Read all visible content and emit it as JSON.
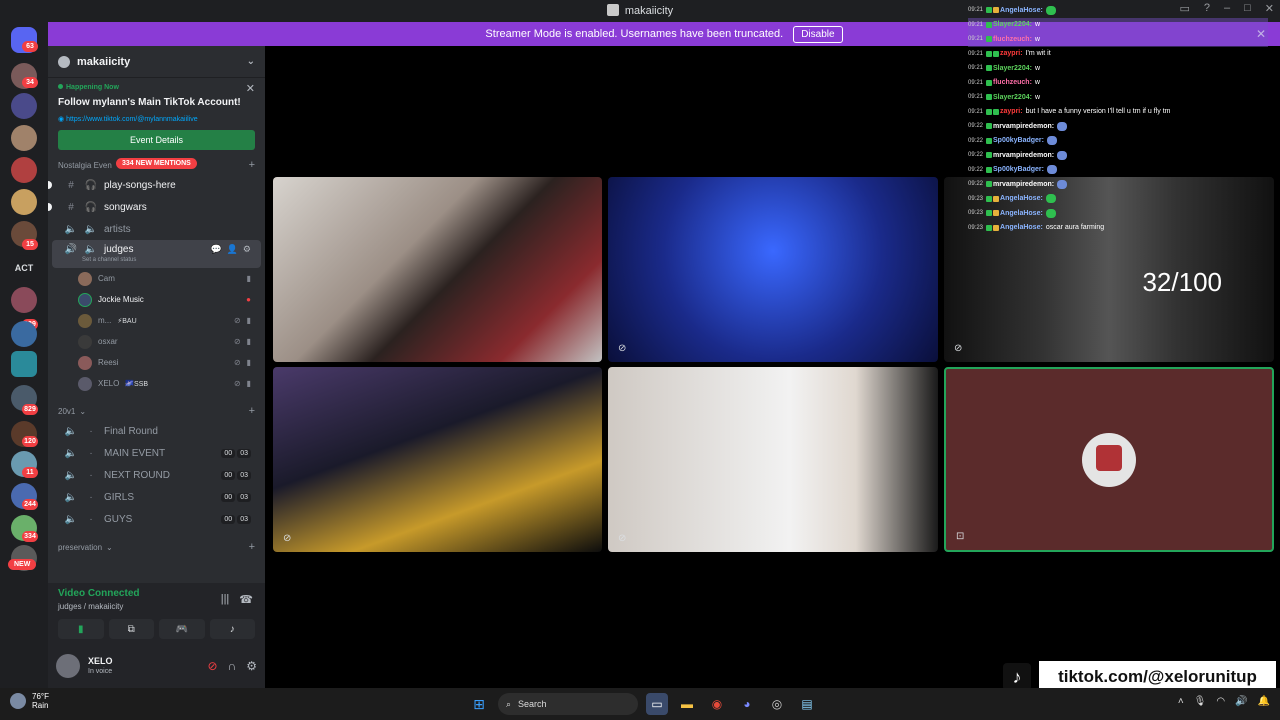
{
  "window": {
    "title": "makaiicity"
  },
  "banner": {
    "text": "Streamer Mode is enabled. Usernames have been truncated.",
    "button": "Disable"
  },
  "servers": {
    "badges": [
      "63",
      "34",
      "15",
      "129",
      "829",
      "120",
      "11",
      "244",
      "334"
    ],
    "text_item": "ACT",
    "new_label": "NEW"
  },
  "sidebar": {
    "server_name": "makaiicity",
    "event": {
      "status": "Happening Now",
      "title": "Follow mylann's Main TikTok Account!",
      "link": "https://www.tiktok.com/@mylannmakaiilive",
      "button": "Event Details"
    },
    "categories": {
      "nostalgia": "Nostalgia Even",
      "mentions_pill": "334 NEW MENTIONS",
      "twenty_v1": "20v1",
      "preservation": "preservation"
    },
    "channels_top": [
      {
        "name": "play-songs-here",
        "unread": true
      },
      {
        "name": "songwars",
        "unread": true
      },
      {
        "name": "artists",
        "unread": false
      }
    ],
    "active_channel": {
      "name": "judges",
      "status": "Set a channel status"
    },
    "voice_users": [
      {
        "name": "Cam",
        "tag": "",
        "speaking": false,
        "color": "#8a6a5a"
      },
      {
        "name": "Jockie Music",
        "tag": "",
        "speaking": true,
        "color": "#3b4a6b"
      },
      {
        "name": "m...",
        "tag": "⚡BAU",
        "speaking": false,
        "color": "#6b5a3b"
      },
      {
        "name": "osxar",
        "tag": "",
        "speaking": false,
        "color": "#3a3a3a"
      },
      {
        "name": "Reesi",
        "tag": "",
        "speaking": false,
        "color": "#8a5a5a"
      },
      {
        "name": "XELO",
        "tag": "🌌SSB",
        "speaking": false,
        "color": "#5a5a6a"
      }
    ],
    "round_channels": [
      {
        "name": "Final Round",
        "count_a": "",
        "count_b": ""
      },
      {
        "name": "MAIN EVENT",
        "count_a": "00",
        "count_b": "03"
      },
      {
        "name": "NEXT ROUND",
        "count_a": "00",
        "count_b": "03"
      },
      {
        "name": "GIRLS",
        "count_a": "00",
        "count_b": "03"
      },
      {
        "name": "GUYS",
        "count_a": "00",
        "count_b": "03"
      }
    ]
  },
  "voice_panel": {
    "status": "Video Connected",
    "location": "judges / makaiicity"
  },
  "user_panel": {
    "name": "XELO",
    "status": "In voice"
  },
  "stage": {
    "score_text": "32/100"
  },
  "chat": [
    {
      "time": "09:21",
      "user": "AngelaHose:",
      "msg": "",
      "color": "#8ab4ff",
      "emote": true,
      "hl": false
    },
    {
      "time": "09:21",
      "user": "Slayer2204:",
      "msg": "w",
      "color": "#5dd35d",
      "emote": false,
      "hl": true
    },
    {
      "time": "09:21",
      "user": "fluchzeuch:",
      "msg": "w",
      "color": "#ff6fa8",
      "emote": false,
      "hl": true
    },
    {
      "time": "09:21",
      "user": "zaypri:",
      "msg": "I'm wit it",
      "color": "#ff3b3b",
      "emote": false,
      "hl": false
    },
    {
      "time": "09:21",
      "user": "Slayer2204:",
      "msg": "w",
      "color": "#5dd35d",
      "emote": false,
      "hl": false
    },
    {
      "time": "09:21",
      "user": "fluchzeuch:",
      "msg": "w",
      "color": "#ff6fa8",
      "emote": false,
      "hl": false
    },
    {
      "time": "09:21",
      "user": "Slayer2204:",
      "msg": "w",
      "color": "#5dd35d",
      "emote": false,
      "hl": false
    },
    {
      "time": "09:21",
      "user": "zaypri:",
      "msg": "but I have a funny version I'll tell u tm if u fly tm",
      "color": "#ff3b3b",
      "emote": false,
      "hl": false
    },
    {
      "time": "09:22",
      "user": "mrvampiredemon:",
      "msg": "",
      "color": "#ffffff",
      "emote": true,
      "hl": false
    },
    {
      "time": "09:22",
      "user": "Sp00kyBadger:",
      "msg": "",
      "color": "#8ab4ff",
      "emote": true,
      "hl": false
    },
    {
      "time": "09:22",
      "user": "mrvampiredemon:",
      "msg": "",
      "color": "#ffffff",
      "emote": true,
      "hl": false
    },
    {
      "time": "09:22",
      "user": "Sp00kyBadger:",
      "msg": "",
      "color": "#8ab4ff",
      "emote": true,
      "hl": false
    },
    {
      "time": "09:22",
      "user": "mrvampiredemon:",
      "msg": "",
      "color": "#ffffff",
      "emote": true,
      "hl": false
    },
    {
      "time": "09:23",
      "user": "AngelaHose:",
      "msg": "",
      "color": "#8ab4ff",
      "emote": true,
      "hl": false
    },
    {
      "time": "09:23",
      "user": "AngelaHose:",
      "msg": "",
      "color": "#8ab4ff",
      "emote": true,
      "hl": false
    },
    {
      "time": "09:23",
      "user": "AngelaHose:",
      "msg": "oscar aura farming",
      "color": "#8ab4ff",
      "emote": false,
      "hl": false
    }
  ],
  "overlay": {
    "tiktok_handle": "tiktok.com/@xelorunitup"
  },
  "taskbar": {
    "temp": "76°F",
    "condition": "Rain",
    "search": "Search"
  }
}
